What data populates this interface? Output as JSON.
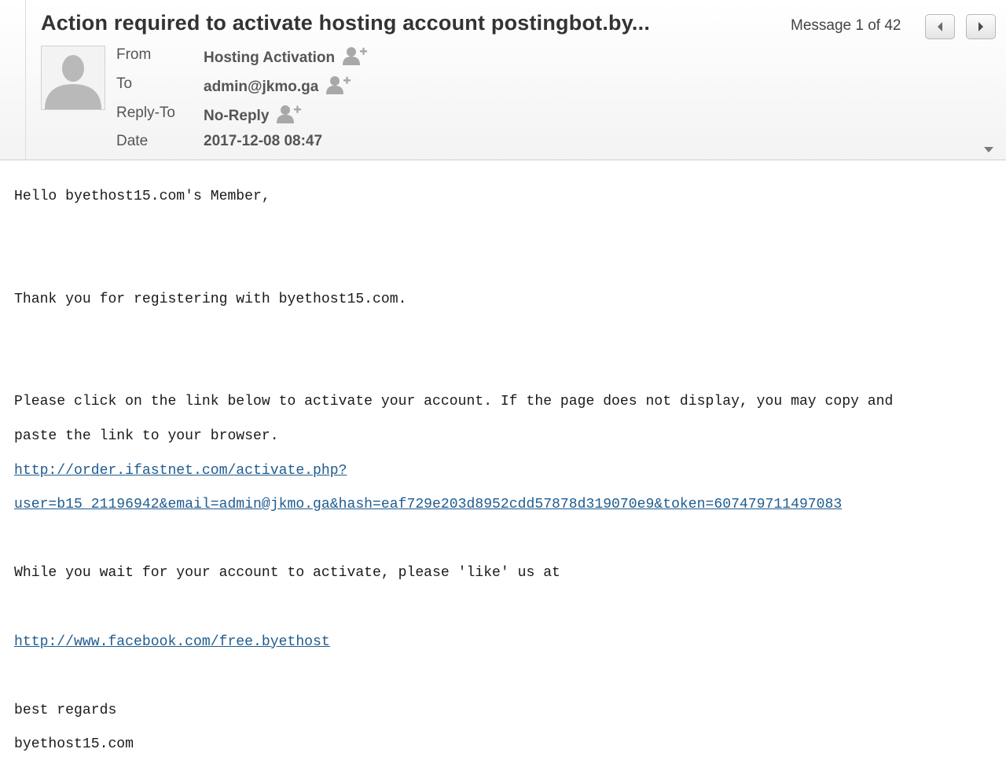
{
  "header": {
    "subject": "Action required to activate hosting account postingbot.by...",
    "counter": "Message 1 of 42",
    "fields": {
      "from": {
        "label": "From",
        "value": "Hosting Activation"
      },
      "to": {
        "label": "To",
        "value": "admin@jkmo.ga"
      },
      "reply_to": {
        "label": "Reply-To",
        "value": "No-Reply"
      },
      "date": {
        "label": "Date",
        "value": "2017-12-08 08:47"
      }
    }
  },
  "icons": {
    "prev": "chevron-left-icon",
    "next": "chevron-right-icon",
    "add_contact": "add-contact-icon",
    "expand": "caret-down-icon",
    "avatar": "person-silhouette-icon"
  },
  "body": {
    "greeting": "Hello byethost15.com's Member,",
    "thanks": "Thank you for registering with byethost15.com.",
    "instruction_1": "Please click on the link below to activate your account. If the page does not display, you may copy and",
    "instruction_2": "paste the link to your browser.",
    "activation_link_1": "http://order.ifastnet.com/activate.php?",
    "activation_link_2": "user=b15_21196942&email=admin@jkmo.ga&hash=eaf729e203d8952cdd57878d319070e9&token=607479711497083",
    "wait_text": "While you wait for your account to activate, please 'like' us at",
    "facebook_link": "http://www.facebook.com/free.byethost",
    "closing_1": "best regards",
    "closing_2": "byethost15.com"
  },
  "colors": {
    "link": "#1f5c8f",
    "header_bg": "#f3f3f3",
    "icon_gray": "#a8a8a8"
  }
}
